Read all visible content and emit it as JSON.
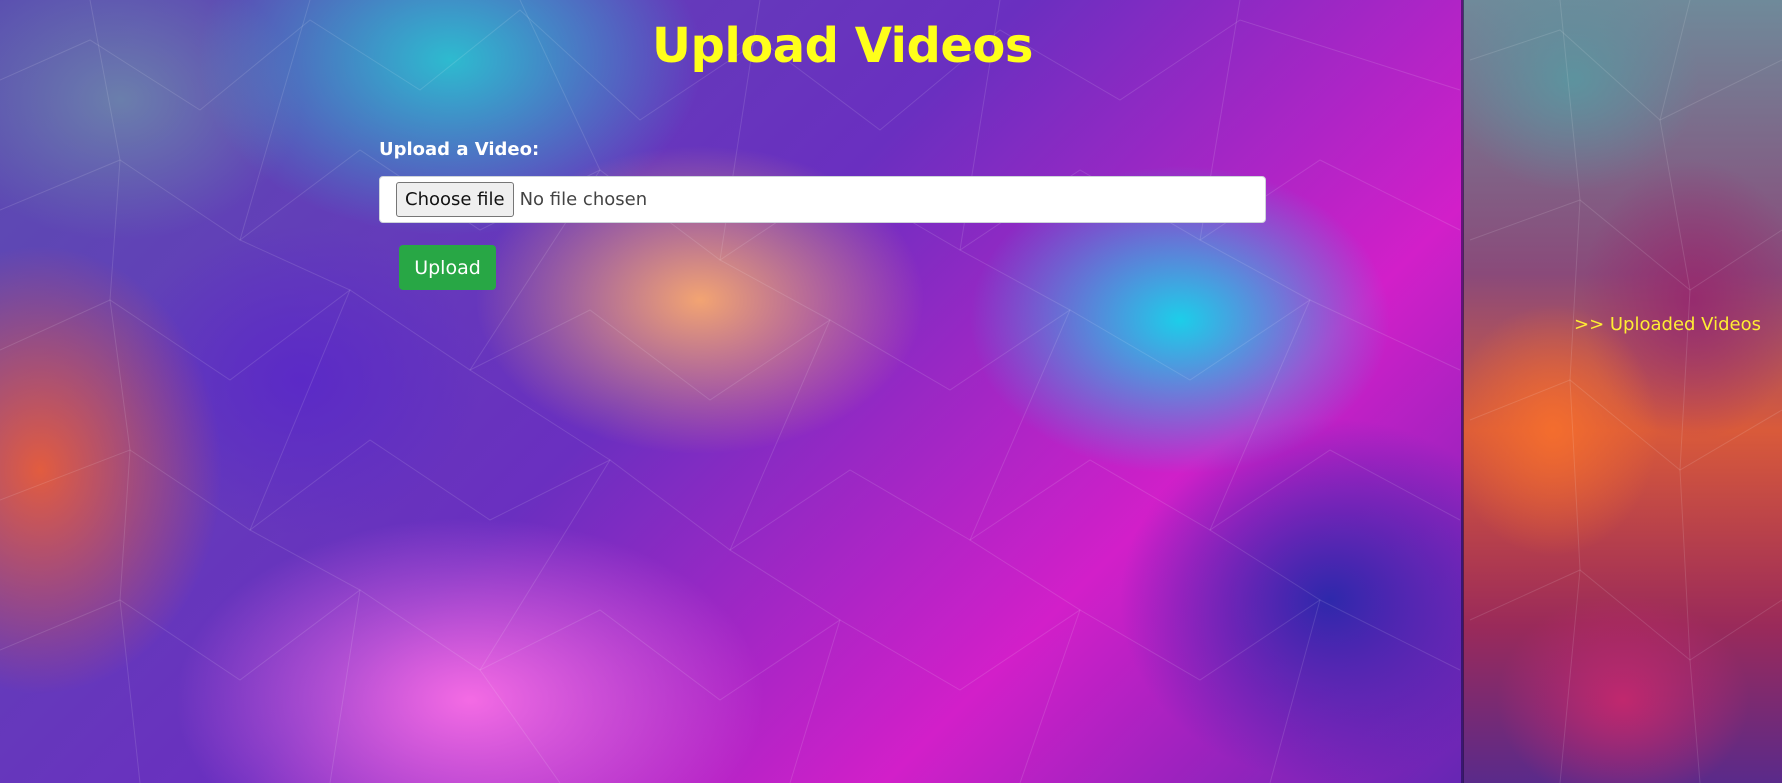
{
  "page": {
    "title": "Upload Videos"
  },
  "form": {
    "label": "Upload a Video:",
    "file_input": {
      "button_label": "Choose file",
      "status_text": "No file chosen"
    },
    "submit_label": "Upload"
  },
  "sidebar": {
    "link_label": ">> Uploaded Videos"
  },
  "colors": {
    "title": "#ffff1a",
    "link": "#ffee33",
    "submit_button": "#28a745"
  }
}
